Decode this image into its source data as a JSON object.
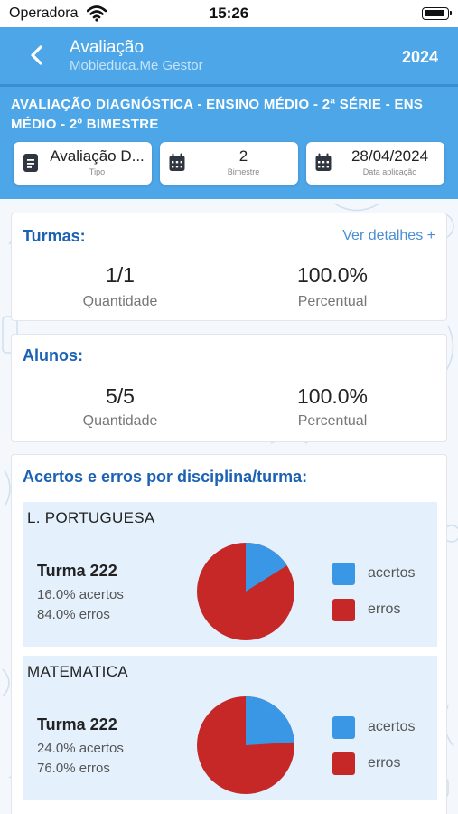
{
  "status_bar": {
    "carrier": "Operadora",
    "time": "15:26"
  },
  "nav": {
    "title": "Avaliação",
    "subtitle": "Mobieduca.Me Gestor",
    "year": "2024"
  },
  "evaluation": {
    "title": "AVALIAÇÃO DIAGNÓSTICA - ENSINO MÉDIO - 2ª SÉRIE - ENS MÉDIO - 2º BIMESTRE",
    "info": [
      {
        "value": "Avaliação D...",
        "label": "Tipo",
        "icon": "document-icon"
      },
      {
        "value": "2",
        "label": "Bimestre",
        "icon": "calendar-icon"
      },
      {
        "value": "28/04/2024",
        "label": "Data aplicação",
        "icon": "calendar-icon"
      }
    ]
  },
  "turmas": {
    "title": "Turmas:",
    "link": "Ver detalhes +",
    "quantity": "1/1",
    "quantity_label": "Quantidade",
    "percent": "100.0%",
    "percent_label": "Percentual"
  },
  "alunos": {
    "title": "Alunos:",
    "quantity": "5/5",
    "quantity_label": "Quantidade",
    "percent": "100.0%",
    "percent_label": "Percentual"
  },
  "disciplinas": {
    "title": "Acertos e erros por disciplina/turma:",
    "legend": {
      "hits": "acertos",
      "errors": "erros"
    },
    "colors": {
      "hits": "#3a97e6",
      "errors": "#c62828"
    },
    "items": [
      {
        "name": "L. PORTUGUESA",
        "turma": "Turma 222",
        "hits_text": "16.0% acertos",
        "errors_text": "84.0% erros",
        "hits_pct": 16.0
      },
      {
        "name": "MATEMATICA",
        "turma": "Turma 222",
        "hits_text": "24.0% acertos",
        "errors_text": "76.0% erros",
        "hits_pct": 24.0
      }
    ]
  }
}
